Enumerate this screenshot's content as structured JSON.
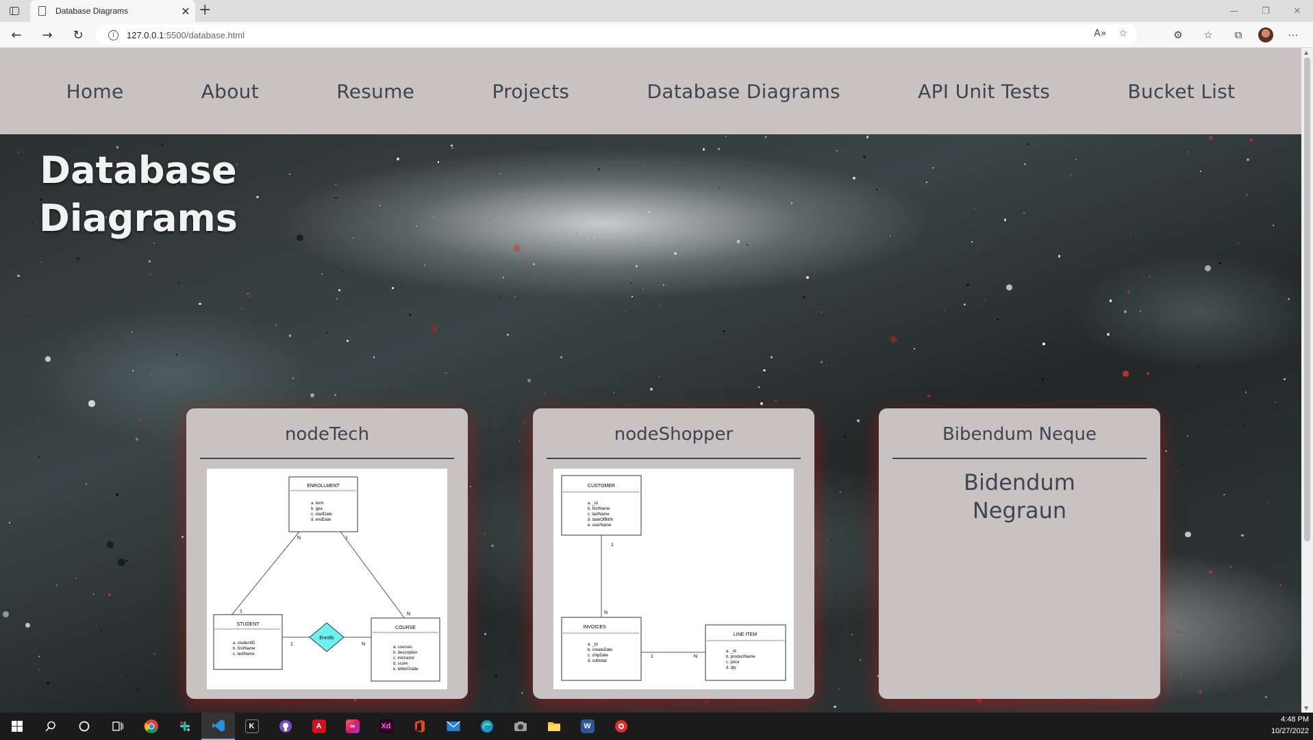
{
  "browser": {
    "tab_title": "Database Diagrams",
    "tab_close": "✕",
    "new_tab": "+",
    "url_host": "127.0.0.1",
    "url_rest": ":5500/database.html"
  },
  "site_nav": [
    {
      "label": "Home"
    },
    {
      "label": "About"
    },
    {
      "label": "Resume"
    },
    {
      "label": "Projects"
    },
    {
      "label": "Database Diagrams"
    },
    {
      "label": "API Unit Tests"
    },
    {
      "label": "Bucket List"
    }
  ],
  "page": {
    "title_line1": "Database",
    "title_line2": "Diagrams"
  },
  "cards": [
    {
      "title": "nodeTech",
      "diagram": {
        "enrollment": {
          "name": "ENROLLMENT",
          "fields": [
            "a. term",
            "b. gpa",
            "c. startDate",
            "d. endDate"
          ]
        },
        "student": {
          "name": "STUDENT",
          "fields": [
            "a. studentID",
            "b. firstName",
            "c. lastName"
          ]
        },
        "course": {
          "name": "COURSE",
          "fields": [
            "a. courses",
            "b. description",
            "c. instructor",
            "d. score",
            "e. letterGrade"
          ]
        },
        "relation": "Enrolls",
        "labels": [
          "N",
          "1",
          "1",
          "N",
          "1",
          "N"
        ]
      }
    },
    {
      "title": "nodeShopper",
      "diagram": {
        "customer": {
          "name": "CUSTOMER",
          "fields": [
            "a. _id",
            "b. firstName",
            "c. lastName",
            "d. dateOfBirth",
            "e. userName"
          ]
        },
        "invoices": {
          "name": "INVOICES",
          "fields": [
            "a. _id",
            "b. createDate",
            "c. shipDate",
            "d. subtotal"
          ]
        },
        "line_item": {
          "name": "LINE ITEM",
          "fields": [
            "a. _id",
            "b. productName",
            "c. price",
            "d. qty"
          ]
        },
        "labels": [
          "1",
          "N",
          "1",
          "N"
        ]
      }
    },
    {
      "title": "Bibendum Neque",
      "body_line1": "Bidendum",
      "body_line2": "Negraun"
    }
  ],
  "taskbar": {
    "time": "4:48 PM",
    "date": "10/27/2022",
    "apps": [
      "start-icon",
      "search-icon",
      "cortana-icon",
      "task-view-icon",
      "chrome-icon",
      "slack-icon",
      "vscode-icon",
      "kotlin-icon",
      "github-icon",
      "acrobat-icon",
      "creative-cloud-icon",
      "xd-icon",
      "office-icon",
      "mail-icon",
      "edge-icon",
      "camera-icon",
      "file-explorer-icon",
      "word-icon",
      "record-icon"
    ],
    "xd_label": "Xd",
    "word_label": "W"
  },
  "colors": {
    "nav_bg": "#c8c2c2",
    "nav_text": "#3f4550",
    "card_shadow": "#c81414",
    "relation_fill": "#6ef0f0"
  }
}
